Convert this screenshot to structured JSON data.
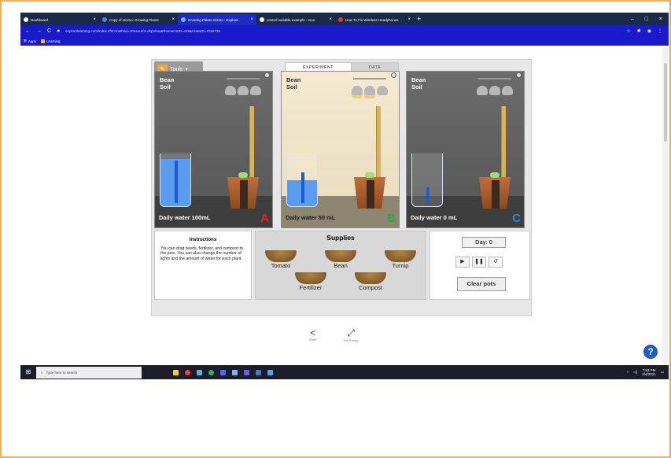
{
  "browser": {
    "tabs": [
      {
        "label": "Dashboard",
        "color": "#ffffff"
      },
      {
        "label": "Copy of Gizmo: Growing Plants",
        "color": "#4285f4"
      },
      {
        "label": "Growing Plants Gizmo : Explore",
        "color": "#3b82f6"
      },
      {
        "label": "control variable example - Goo",
        "color": "#ffffff"
      },
      {
        "label": "How To Fix Wireless Headphones",
        "color": "#e53935"
      }
    ],
    "new_tab": "+",
    "url": "explorelearning.com/index.cfm?method=cResource.dspView&ResourceID=415&ClassID=3782739",
    "url_host": "explorelearning.com",
    "bookmarks": [
      "Apps",
      "Learning"
    ]
  },
  "gizmo": {
    "tools_label": "Tools",
    "tabs": [
      "EXPERIMENT",
      "DATA"
    ],
    "chambers": [
      {
        "line1": "Bean",
        "line2": "Soil",
        "daily": "Daily water  100mL",
        "letter": "A",
        "letter_color": "#e0222a",
        "water_fraction": 0.9
      },
      {
        "line1": "Bean",
        "line2": "Soil",
        "daily": "Daily water  50  mL",
        "letter": "B",
        "letter_color": "#2aa84a",
        "water_fraction": 0.5
      },
      {
        "line1": "Bean",
        "line2": "Soil",
        "daily": "Daily water  0   mL",
        "letter": "C",
        "letter_color": "#2b84e0",
        "water_fraction": 0.0
      }
    ],
    "instructions": {
      "title": "Instructions",
      "text": "You can drag seeds, fertilizer, and compost to the pots. You can also change the number of lights and the amount of water for each plant."
    },
    "supplies": {
      "title": "Supplies",
      "items": [
        "Tomato",
        "Bean",
        "Turnip",
        "Fertilizer",
        "Compost"
      ]
    },
    "controls": {
      "day": "Day: 0",
      "clear": "Clear pots"
    },
    "share": {
      "share_label": "Share",
      "fullscreen_label": "Full Screen"
    }
  },
  "taskbar": {
    "search_placeholder": "Type here to search",
    "time": "7:53 PM",
    "date": "2/4/2021"
  }
}
